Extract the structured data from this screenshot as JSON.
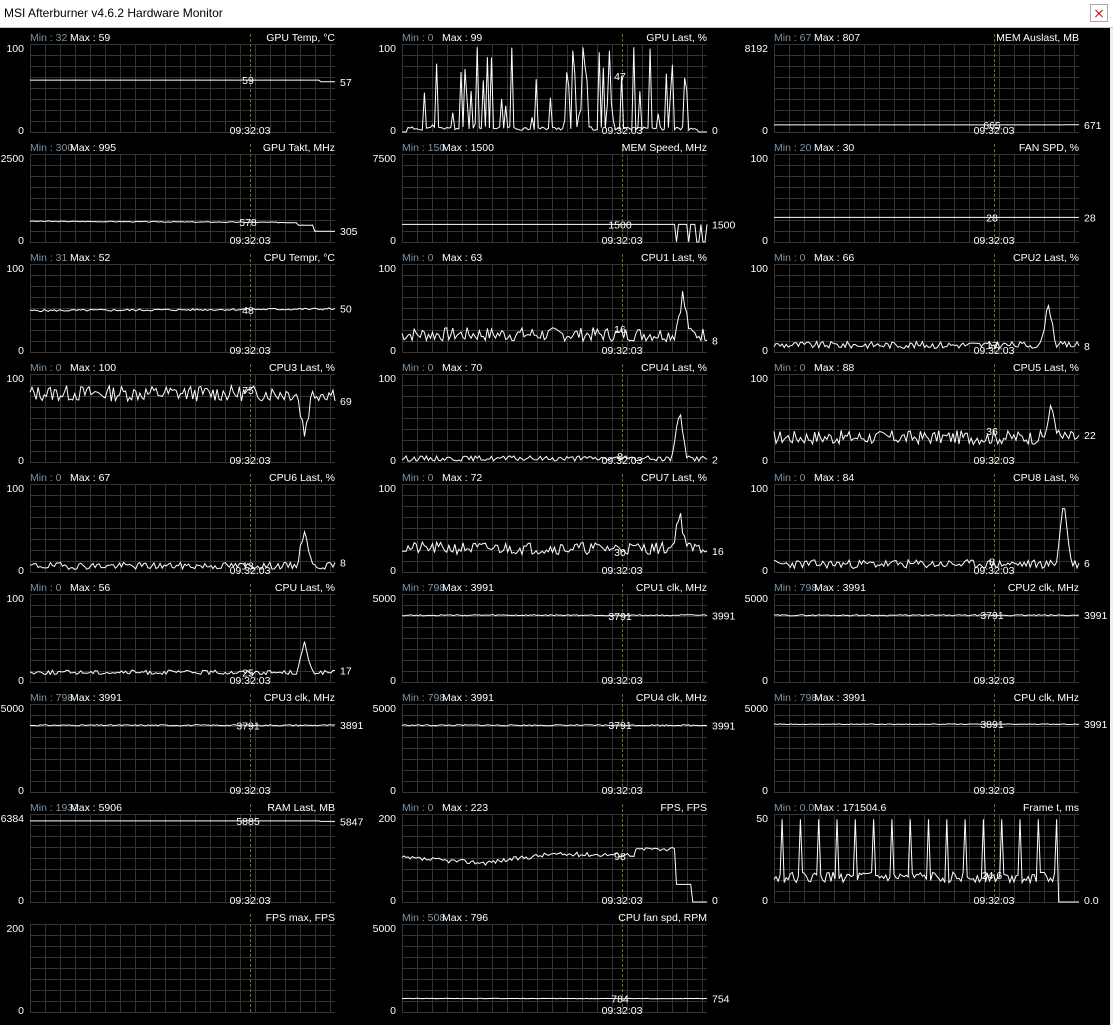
{
  "window": {
    "title": "MSI Afterburner v4.6.2 Hardware Monitor"
  },
  "colors": {
    "background": "#000000",
    "grid": "#343434",
    "line": "#ffffff",
    "label": "#ffffff",
    "min_label": "#7c95a6",
    "cursor": "#6a6a2a"
  },
  "cursor_time": "09:32:03",
  "graphs": [
    {
      "name": "GPU Temp, °C",
      "min_label": "Min : 32",
      "max_label": "Max : 59",
      "y_top": "100",
      "y_bottom": "0",
      "cursor_value": "59",
      "end_value": "57",
      "trace": {
        "shape": "flat",
        "levels": [
          [
            0,
            59
          ],
          [
            0.97,
            57
          ],
          [
            1,
            57
          ]
        ]
      }
    },
    {
      "name": "GPU Last, %",
      "min_label": "Min : 0",
      "max_label": "Max : 99",
      "y_top": "100",
      "y_bottom": "0",
      "cursor_value": "47",
      "end_value": "0",
      "trace": {
        "shape": "spiky",
        "base": 2,
        "peak": 99,
        "density": 0.65,
        "seed": 11,
        "end_drop": 0
      }
    },
    {
      "name": "MEM Auslast, MB",
      "min_label": "Min : 67",
      "max_label": "Max : 807",
      "y_top": "8192",
      "y_bottom": "0",
      "cursor_value": "665",
      "end_value": "671",
      "trace": {
        "shape": "flat",
        "levels": [
          [
            0,
            665
          ],
          [
            1,
            671
          ]
        ]
      }
    },
    {
      "name": "GPU Takt, MHz",
      "min_label": "Min : 300",
      "max_label": "Max : 995",
      "y_top": "2500",
      "y_bottom": "0",
      "cursor_value": "578",
      "end_value": "305",
      "trace": {
        "shape": "noisy_flat",
        "base": 590,
        "noise": 12,
        "seed": 3,
        "drift": -40,
        "steps": [
          [
            0.88,
            480
          ],
          [
            0.93,
            305
          ]
        ]
      }
    },
    {
      "name": "MEM Speed, MHz",
      "min_label": "Min : 150",
      "max_label": "Max : 1500",
      "y_top": "7500",
      "y_bottom": "0",
      "cursor_value": "1500",
      "end_value": "1500",
      "trace": {
        "shape": "flat_dips",
        "base": 1500,
        "dips": [
          0.9,
          0.94,
          0.97,
          0.99
        ],
        "dip_to": 0
      }
    },
    {
      "name": "FAN SPD, %",
      "min_label": "Min : 20",
      "max_label": "Max : 30",
      "y_top": "100",
      "y_bottom": "0",
      "cursor_value": "28",
      "end_value": "28",
      "trace": {
        "shape": "flat",
        "levels": [
          [
            0,
            28
          ],
          [
            1,
            28
          ]
        ]
      }
    },
    {
      "name": "CPU Tempr, °C",
      "min_label": "Min : 31",
      "max_label": "Max : 52",
      "y_top": "100",
      "y_bottom": "0",
      "cursor_value": "48",
      "end_value": "50",
      "trace": {
        "shape": "noisy_flat",
        "base": 47,
        "noise": 1.2,
        "seed": 5,
        "drift": 2,
        "steps": []
      }
    },
    {
      "name": "CPU1 Last, %",
      "min_label": "Min : 0",
      "max_label": "Max : 63",
      "y_top": "100",
      "y_bottom": "0",
      "cursor_value": "16",
      "end_value": "8",
      "trace": {
        "shape": "noise",
        "base": 20,
        "noise": 8,
        "seed": 7,
        "spike_at": 0.92,
        "spike": 45
      }
    },
    {
      "name": "CPU2 Last, %",
      "min_label": "Min : 0",
      "max_label": "Max : 66",
      "y_top": "100",
      "y_bottom": "0",
      "cursor_value": "17",
      "end_value": "8",
      "trace": {
        "shape": "noise",
        "base": 8,
        "noise": 4,
        "seed": 9,
        "spike_at": 0.9,
        "spike": 48
      }
    },
    {
      "name": "CPU3 Last, %",
      "min_label": "Min : 0",
      "max_label": "Max : 100",
      "y_top": "100",
      "y_bottom": "0",
      "cursor_value": "75",
      "end_value": "69",
      "trace": {
        "shape": "noise",
        "base": 78,
        "noise": 9,
        "seed": 13,
        "spike_at": 0.9,
        "spike": -45
      }
    },
    {
      "name": "CPU4 Last, %",
      "min_label": "Min : 0",
      "max_label": "Max : 70",
      "y_top": "100",
      "y_bottom": "0",
      "cursor_value": "8",
      "end_value": "2",
      "trace": {
        "shape": "noise",
        "base": 4,
        "noise": 3,
        "seed": 15,
        "spike_at": 0.91,
        "spike": 55
      }
    },
    {
      "name": "CPU5 Last, %",
      "min_label": "Min : 0",
      "max_label": "Max : 88",
      "y_top": "100",
      "y_bottom": "0",
      "cursor_value": "36",
      "end_value": "22",
      "trace": {
        "shape": "noise",
        "base": 28,
        "noise": 8,
        "seed": 17,
        "spike_at": 0.91,
        "spike": 35
      }
    },
    {
      "name": "CPU6 Last, %",
      "min_label": "Min : 0",
      "max_label": "Max : 67",
      "y_top": "100",
      "y_bottom": "0",
      "cursor_value": "13",
      "end_value": "8",
      "trace": {
        "shape": "noise",
        "base": 7,
        "noise": 4,
        "seed": 19,
        "spike_at": 0.9,
        "spike": 42
      }
    },
    {
      "name": "CPU7 Last, %",
      "min_label": "Min : 0",
      "max_label": "Max : 72",
      "y_top": "100",
      "y_bottom": "0",
      "cursor_value": "30",
      "end_value": "16",
      "trace": {
        "shape": "noise",
        "base": 27,
        "noise": 7,
        "seed": 21,
        "spike_at": 0.91,
        "spike": 40
      }
    },
    {
      "name": "CPU8 Last, %",
      "min_label": "Min : 0",
      "max_label": "Max : 84",
      "y_top": "100",
      "y_bottom": "0",
      "cursor_value": "8",
      "end_value": "6",
      "trace": {
        "shape": "noise",
        "base": 9,
        "noise": 5,
        "seed": 23,
        "spike_at": 0.95,
        "spike": 72
      }
    },
    {
      "name": "CPU Last, %",
      "min_label": "Min : 0",
      "max_label": "Max : 56",
      "y_top": "100",
      "y_bottom": "0",
      "cursor_value": "25",
      "end_value": "17",
      "trace": {
        "shape": "noise",
        "base": 11,
        "noise": 2.5,
        "seed": 25,
        "spike_at": 0.9,
        "spike": 33
      }
    },
    {
      "name": "CPU1 clk, MHz",
      "min_label": "Min : 798",
      "max_label": "Max : 3991",
      "y_top": "5000",
      "y_bottom": "0",
      "cursor_value": "3791",
      "end_value": "3991",
      "trace": {
        "shape": "noisy_flat",
        "base": 3791,
        "noise": 35,
        "seed": 27,
        "drift": 0,
        "steps": []
      }
    },
    {
      "name": "CPU2 clk, MHz",
      "min_label": "Min : 798",
      "max_label": "Max : 3991",
      "y_top": "5000",
      "y_bottom": "0",
      "cursor_value": "3791",
      "end_value": "3991",
      "trace": {
        "shape": "noisy_flat",
        "base": 3791,
        "noise": 35,
        "seed": 29,
        "drift": 0,
        "steps": []
      }
    },
    {
      "name": "CPU3 clk, MHz",
      "min_label": "Min : 798",
      "max_label": "Max : 3991",
      "y_top": "5000",
      "y_bottom": "0",
      "cursor_value": "3791",
      "end_value": "3891",
      "trace": {
        "shape": "noisy_flat",
        "base": 3791,
        "noise": 35,
        "seed": 31,
        "drift": 0,
        "steps": []
      }
    },
    {
      "name": "CPU4 clk, MHz",
      "min_label": "Min : 798",
      "max_label": "Max : 3991",
      "y_top": "5000",
      "y_bottom": "0",
      "cursor_value": "3791",
      "end_value": "3991",
      "trace": {
        "shape": "noisy_flat",
        "base": 3791,
        "noise": 35,
        "seed": 33,
        "drift": 0,
        "steps": []
      }
    },
    {
      "name": "CPU clk, MHz",
      "min_label": "Min : 798",
      "max_label": "Max : 3991",
      "y_top": "5000",
      "y_bottom": "0",
      "cursor_value": "3891",
      "end_value": "3991",
      "trace": {
        "shape": "noisy_flat",
        "base": 3850,
        "noise": 20,
        "seed": 35,
        "drift": 0,
        "steps": []
      }
    },
    {
      "name": "RAM Last, MB",
      "min_label": "Min : 1932",
      "max_label": "Max : 5906",
      "y_top": "6384",
      "y_bottom": "0",
      "cursor_value": "5885",
      "end_value": "5847",
      "trace": {
        "shape": "flat",
        "levels": [
          [
            0,
            5885
          ],
          [
            1,
            5847
          ]
        ]
      }
    },
    {
      "name": "FPS, FPS",
      "min_label": "Min : 0",
      "max_label": "Max : 223",
      "y_top": "200",
      "y_bottom": "0",
      "cursor_value": "98",
      "end_value": "0",
      "trace": {
        "shape": "fps",
        "seed": 37
      }
    },
    {
      "name": "Frame t, ms",
      "min_label": "Min : 0.0",
      "max_label": "Max : 171504.6",
      "y_top": "50",
      "y_bottom": "0",
      "cursor_value": "24.6",
      "end_value": "0.0",
      "trace": {
        "shape": "frametime",
        "seed": 39
      }
    },
    {
      "name": "FPS max, FPS",
      "min_label": "",
      "max_label": "",
      "y_top": "200",
      "y_bottom": "0",
      "cursor_value": "",
      "end_value": "",
      "trace": {
        "shape": "none"
      }
    },
    {
      "name": "CPU fan spd, RPM",
      "min_label": "Min : 508",
      "max_label": "Max : 796",
      "y_top": "5000",
      "y_bottom": "0",
      "cursor_value": "784",
      "end_value": "754",
      "trace": {
        "shape": "noisy_flat",
        "base": 770,
        "noise": 12,
        "seed": 41,
        "drift": -10,
        "steps": []
      }
    }
  ]
}
